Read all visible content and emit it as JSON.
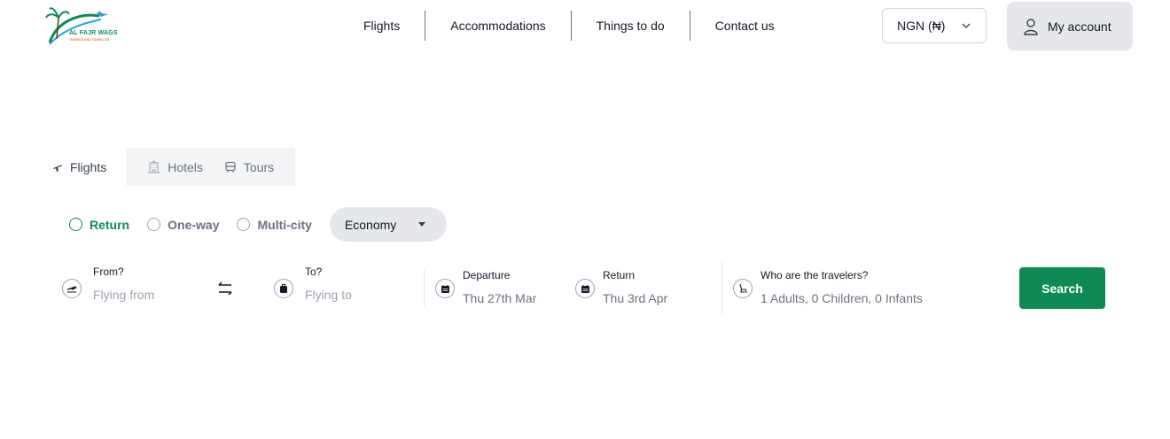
{
  "logo": {
    "name": "AL FAJR WAGS",
    "tagline": "TRAVELS AND TOURS LTD"
  },
  "nav": {
    "items": [
      {
        "label": "Flights"
      },
      {
        "label": "Accommodations"
      },
      {
        "label": "Things to do"
      },
      {
        "label": "Contact us"
      }
    ]
  },
  "currency": {
    "label": "NGN (₦)"
  },
  "account": {
    "label": "My account"
  },
  "tabs": [
    {
      "label": "Flights",
      "icon": "plane-icon",
      "active": true
    },
    {
      "label": "Hotels",
      "icon": "building-icon",
      "active": false
    },
    {
      "label": "Tours",
      "icon": "bus-icon",
      "active": false
    }
  ],
  "trip_type": {
    "options": [
      "Return",
      "One-way",
      "Multi-city"
    ],
    "selected": "Return"
  },
  "cabin": {
    "value": "Economy"
  },
  "search": {
    "from": {
      "label": "From?",
      "placeholder": "Flying from"
    },
    "to": {
      "label": "To?",
      "placeholder": "Flying to"
    },
    "departure": {
      "label": "Departure",
      "value": "Thu 27th Mar"
    },
    "return": {
      "label": "Return",
      "value": "Thu 3rd Apr"
    },
    "travelers": {
      "label": "Who are the travelers?",
      "value": "1 Adults, 0 Children, 0 Infants"
    },
    "button": "Search"
  },
  "colors": {
    "accent": "#0f8a55",
    "muted": "#6b7280",
    "pill": "#e5e7eb"
  }
}
